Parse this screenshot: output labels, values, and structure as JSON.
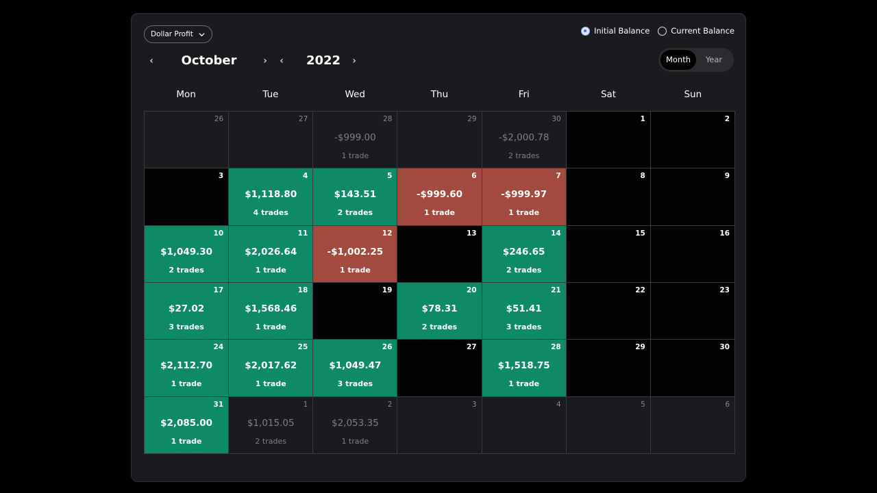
{
  "metric_select": {
    "label": "Dollar Profit",
    "icon": "chevron-down-icon"
  },
  "balance_options": [
    {
      "label": "Initial Balance",
      "checked": true
    },
    {
      "label": "Current Balance",
      "checked": false
    }
  ],
  "nav": {
    "month": "October",
    "year": "2022",
    "prev_icon": "chevron-left-icon",
    "next_icon": "chevron-right-icon"
  },
  "view_toggle": {
    "month": "Month",
    "year": "Year",
    "active": "Month"
  },
  "weekdays": [
    "Mon",
    "Tue",
    "Wed",
    "Thu",
    "Fri",
    "Sat",
    "Sun"
  ],
  "colors": {
    "profit": "#0f8a66",
    "loss": "#a34a3f",
    "empty": "#030303",
    "outside_month": "#1a1b1e",
    "accent": "#3d6fe0"
  },
  "days": [
    {
      "day": "26",
      "pnl": "",
      "trades": "",
      "state": "other"
    },
    {
      "day": "27",
      "pnl": "",
      "trades": "",
      "state": "other"
    },
    {
      "day": "28",
      "pnl": "-$999.00",
      "trades": "1 trade",
      "state": "other"
    },
    {
      "day": "29",
      "pnl": "",
      "trades": "",
      "state": "other"
    },
    {
      "day": "30",
      "pnl": "-$2,000.78",
      "trades": "2 trades",
      "state": "other"
    },
    {
      "day": "1",
      "pnl": "",
      "trades": "",
      "state": "empty"
    },
    {
      "day": "2",
      "pnl": "",
      "trades": "",
      "state": "empty"
    },
    {
      "day": "3",
      "pnl": "",
      "trades": "",
      "state": "empty"
    },
    {
      "day": "4",
      "pnl": "$1,118.80",
      "trades": "4 trades",
      "state": "pos"
    },
    {
      "day": "5",
      "pnl": "$143.51",
      "trades": "2 trades",
      "state": "pos"
    },
    {
      "day": "6",
      "pnl": "-$999.60",
      "trades": "1 trade",
      "state": "neg"
    },
    {
      "day": "7",
      "pnl": "-$999.97",
      "trades": "1 trade",
      "state": "neg"
    },
    {
      "day": "8",
      "pnl": "",
      "trades": "",
      "state": "empty"
    },
    {
      "day": "9",
      "pnl": "",
      "trades": "",
      "state": "empty"
    },
    {
      "day": "10",
      "pnl": "$1,049.30",
      "trades": "2 trades",
      "state": "pos"
    },
    {
      "day": "11",
      "pnl": "$2,026.64",
      "trades": "1 trade",
      "state": "pos"
    },
    {
      "day": "12",
      "pnl": "-$1,002.25",
      "trades": "1 trade",
      "state": "neg"
    },
    {
      "day": "13",
      "pnl": "",
      "trades": "",
      "state": "empty"
    },
    {
      "day": "14",
      "pnl": "$246.65",
      "trades": "2 trades",
      "state": "pos"
    },
    {
      "day": "15",
      "pnl": "",
      "trades": "",
      "state": "empty"
    },
    {
      "day": "16",
      "pnl": "",
      "trades": "",
      "state": "empty"
    },
    {
      "day": "17",
      "pnl": "$27.02",
      "trades": "3 trades",
      "state": "pos"
    },
    {
      "day": "18",
      "pnl": "$1,568.46",
      "trades": "1 trade",
      "state": "pos"
    },
    {
      "day": "19",
      "pnl": "",
      "trades": "",
      "state": "empty"
    },
    {
      "day": "20",
      "pnl": "$78.31",
      "trades": "2 trades",
      "state": "pos"
    },
    {
      "day": "21",
      "pnl": "$51.41",
      "trades": "3 trades",
      "state": "pos"
    },
    {
      "day": "22",
      "pnl": "",
      "trades": "",
      "state": "empty"
    },
    {
      "day": "23",
      "pnl": "",
      "trades": "",
      "state": "empty"
    },
    {
      "day": "24",
      "pnl": "$2,112.70",
      "trades": "1 trade",
      "state": "pos"
    },
    {
      "day": "25",
      "pnl": "$2,017.62",
      "trades": "1 trade",
      "state": "pos"
    },
    {
      "day": "26",
      "pnl": "$1,049.47",
      "trades": "3 trades",
      "state": "pos"
    },
    {
      "day": "27",
      "pnl": "",
      "trades": "",
      "state": "empty"
    },
    {
      "day": "28",
      "pnl": "$1,518.75",
      "trades": "1 trade",
      "state": "pos"
    },
    {
      "day": "29",
      "pnl": "",
      "trades": "",
      "state": "empty"
    },
    {
      "day": "30",
      "pnl": "",
      "trades": "",
      "state": "empty"
    },
    {
      "day": "31",
      "pnl": "$2,085.00",
      "trades": "1 trade",
      "state": "pos"
    },
    {
      "day": "1",
      "pnl": "$1,015.05",
      "trades": "2 trades",
      "state": "other"
    },
    {
      "day": "2",
      "pnl": "$2,053.35",
      "trades": "1 trade",
      "state": "other"
    },
    {
      "day": "3",
      "pnl": "",
      "trades": "",
      "state": "other"
    },
    {
      "day": "4",
      "pnl": "",
      "trades": "",
      "state": "other"
    },
    {
      "day": "5",
      "pnl": "",
      "trades": "",
      "state": "other"
    },
    {
      "day": "6",
      "pnl": "",
      "trades": "",
      "state": "other"
    }
  ]
}
